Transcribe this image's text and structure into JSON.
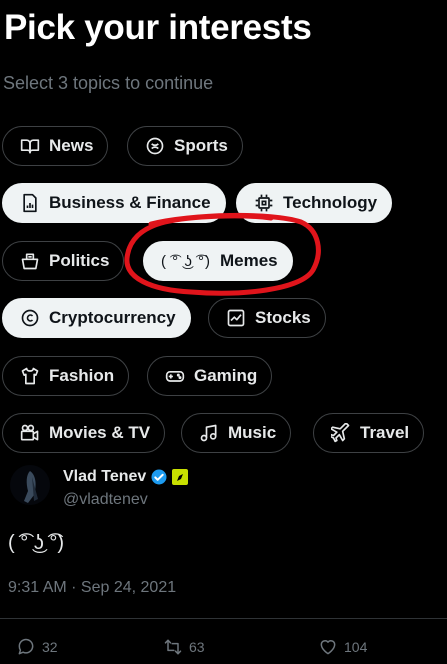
{
  "page": {
    "title": "Pick your interests",
    "subtitle": "Select 3 topics to continue"
  },
  "topics": [
    {
      "label": "News",
      "icon": "book-icon",
      "selected": false
    },
    {
      "label": "Sports",
      "icon": "sports-ball-icon",
      "selected": false
    },
    {
      "label": "Business & Finance",
      "icon": "document-chart-icon",
      "selected": true
    },
    {
      "label": "Technology",
      "icon": "chip-icon",
      "selected": true
    },
    {
      "label": "Politics",
      "icon": "ballot-box-icon",
      "selected": false
    },
    {
      "label": "Memes",
      "icon": "lenny-face",
      "icon_text": "( ͡° ͜ʖ ͡°)",
      "selected": true
    },
    {
      "label": "Cryptocurrency",
      "icon": "copyright-coin-icon",
      "selected": true
    },
    {
      "label": "Stocks",
      "icon": "stock-chart-icon",
      "selected": false
    },
    {
      "label": "Fashion",
      "icon": "tshirt-icon",
      "selected": false
    },
    {
      "label": "Gaming",
      "icon": "gamepad-icon",
      "selected": false
    },
    {
      "label": "Movies & TV",
      "icon": "movie-camera-icon",
      "selected": false
    },
    {
      "label": "Music",
      "icon": "music-note-icon",
      "selected": false
    },
    {
      "label": "Travel",
      "icon": "airplane-icon",
      "selected": false
    }
  ],
  "tweet": {
    "author_name": "Vlad Tenev",
    "handle": "@vladtenev",
    "body": "( ͡° ͜ʖ ͡°)",
    "timestamp": "9:31 AM · Sep 24, 2021",
    "replies": "32",
    "retweets": "63",
    "likes": "104"
  },
  "colors": {
    "background": "#000000",
    "chip_selected_bg": "#eff3f4",
    "chip_border": "#3e4144",
    "muted_text": "#6e767d",
    "verified_blue": "#1d9bf0",
    "annotation_red": "#e0141b",
    "badge_yellow": "#c8e000"
  }
}
